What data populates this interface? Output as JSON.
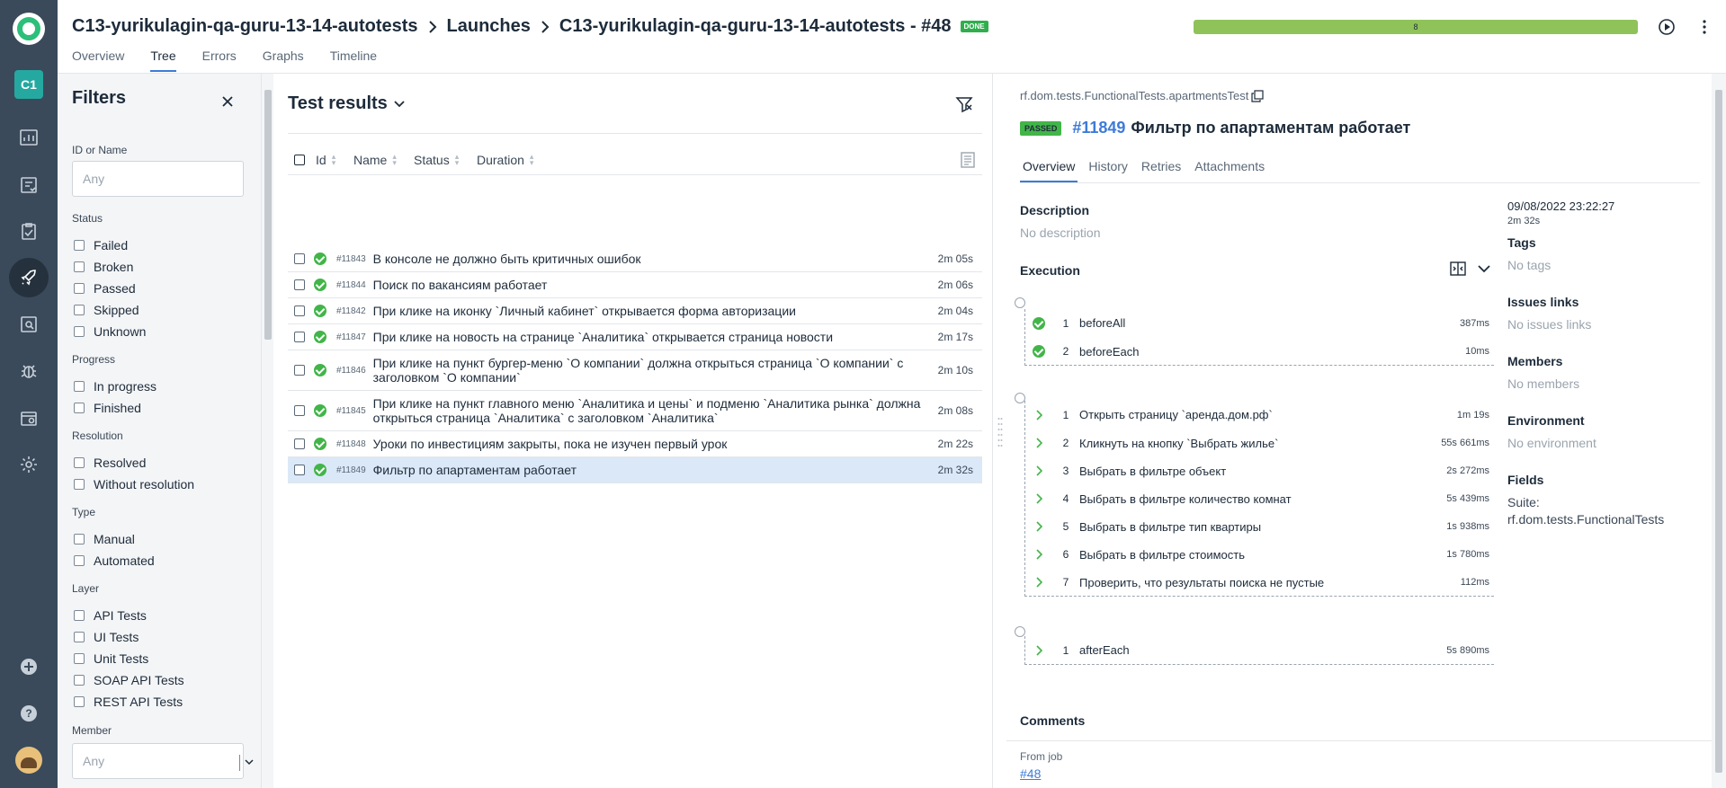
{
  "breadcrumb": {
    "project": "C13-yurikulagin-qa-guru-13-14-autotests",
    "section": "Launches",
    "launch": "C13-yurikulagin-qa-guru-13-14-autotests - #48",
    "status_badge": "DONE"
  },
  "rail": {
    "project_short": "C1"
  },
  "progress": {
    "value": "8",
    "passed_fraction": 1.0,
    "color": "#8fc35a"
  },
  "header_tabs": [
    "Overview",
    "Tree",
    "Errors",
    "Graphs",
    "Timeline"
  ],
  "active_tab": "Tree",
  "filters": {
    "title": "Filters",
    "id_or_name": {
      "label": "ID or Name",
      "placeholder": "Any"
    },
    "groups": [
      {
        "label": "Status",
        "options": [
          "Failed",
          "Broken",
          "Passed",
          "Skipped",
          "Unknown"
        ]
      },
      {
        "label": "Progress",
        "options": [
          "In progress",
          "Finished"
        ]
      },
      {
        "label": "Resolution",
        "options": [
          "Resolved",
          "Without resolution"
        ]
      },
      {
        "label": "Type",
        "options": [
          "Manual",
          "Automated"
        ]
      },
      {
        "label": "Layer",
        "options": [
          "API Tests",
          "UI Tests",
          "Unit Tests",
          "SOAP API Tests",
          "REST API Tests"
        ]
      }
    ],
    "member": {
      "label": "Member",
      "placeholder": "Any"
    }
  },
  "results": {
    "title": "Test results",
    "columns": [
      "Id",
      "Name",
      "Status",
      "Duration"
    ],
    "rows": [
      {
        "id": "#11843",
        "name": "В консоле не должно быть критичных ошибок",
        "duration": "2m 05s"
      },
      {
        "id": "#11844",
        "name": "Поиск по вакансиям работает",
        "duration": "2m 06s"
      },
      {
        "id": "#11842",
        "name": "При клике на иконку `Личный кабинет` открывается форма авторизации",
        "duration": "2m 04s"
      },
      {
        "id": "#11847",
        "name": "При клике на новость на странице `Аналитика` открывается страница новости",
        "duration": "2m 17s"
      },
      {
        "id": "#11846",
        "name": "При клике на пункт бургер-меню `О компании` должна открыться страница `О компании` с заголовком `О компании`",
        "duration": "2m 10s"
      },
      {
        "id": "#11845",
        "name": "При клике на пункт главного меню `Аналитика и цены` и подменю `Аналитика рынка` должна открыться страница `Аналитика` с заголовком `Аналитика`",
        "duration": "2m 08s"
      },
      {
        "id": "#11848",
        "name": "Уроки по инвестициям закрыты, пока не изучен первый урок",
        "duration": "2m 22s"
      },
      {
        "id": "#11849",
        "name": "Фильтр по апартаментам работает",
        "duration": "2m 32s"
      }
    ],
    "selected_id": "#11849"
  },
  "details": {
    "path": "rf.dom.tests.FunctionalTests.apartmentsTest",
    "status": "PASSED",
    "id": "#11849",
    "title": "Фильтр по апартаментам работает",
    "tabs": [
      "Overview",
      "History",
      "Retries",
      "Attachments"
    ],
    "description_label": "Description",
    "description_value": "No description",
    "execution_label": "Execution",
    "before": [
      {
        "n": "1",
        "name": "beforeAll",
        "dur": "387ms"
      },
      {
        "n": "2",
        "name": "beforeEach",
        "dur": "10ms"
      }
    ],
    "steps": [
      {
        "n": "1",
        "name": "Открыть страницу `аренда.дом.рф`",
        "dur": "1m 19s"
      },
      {
        "n": "2",
        "name": "Кликнуть на кнопку `Выбрать жилье`",
        "dur": "55s 661ms"
      },
      {
        "n": "3",
        "name": "Выбрать в фильтре объект",
        "dur": "2s 272ms"
      },
      {
        "n": "4",
        "name": "Выбрать в фильтре количество комнат",
        "dur": "5s 439ms"
      },
      {
        "n": "5",
        "name": "Выбрать в фильтре тип квартиры",
        "dur": "1s 938ms"
      },
      {
        "n": "6",
        "name": "Выбрать в фильтре стоимость",
        "dur": "1s 780ms"
      },
      {
        "n": "7",
        "name": "Проверить, что результаты поиска не пустые",
        "dur": "112ms"
      }
    ],
    "after": [
      {
        "n": "1",
        "name": "afterEach",
        "dur": "5s 890ms"
      }
    ],
    "comments_label": "Comments",
    "date": "09/08/2022 23:22:27",
    "duration": "2m 32s",
    "tags_label": "Tags",
    "tags_value": "No tags",
    "issues_label": "Issues links",
    "issues_value": "No issues links",
    "members_label": "Members",
    "members_value": "No members",
    "env_label": "Environment",
    "env_value": "No environment",
    "fields_label": "Fields",
    "fields_suite": "Suite:",
    "fields_suite_value": "rf.dom.tests.FunctionalTests",
    "from_job_label": "From job",
    "from_job_value": "#48"
  }
}
